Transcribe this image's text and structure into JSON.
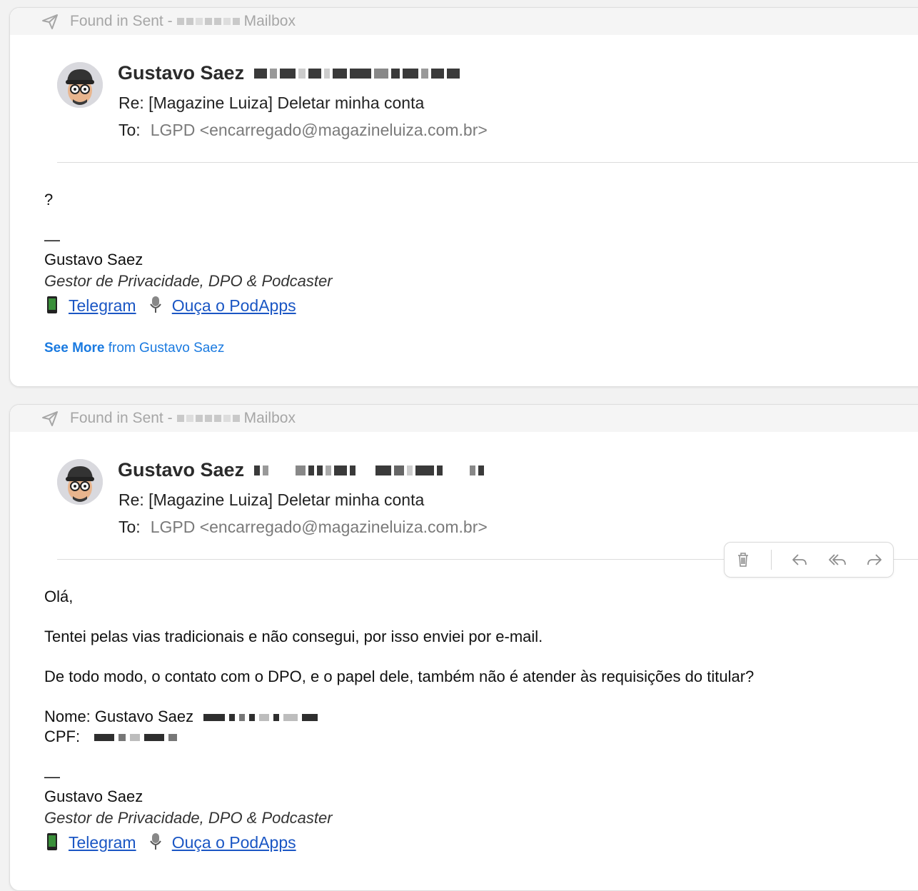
{
  "messages": [
    {
      "found_label": "Found in Sent -",
      "mailbox_label": "Mailbox",
      "sender": "Gustavo Saez",
      "subject": "Re: [Magazine Luiza] Deletar minha conta",
      "to_label": "To:",
      "to_value": "LGPD <encarregado@magazineluiza.com.br>",
      "body": [
        "?"
      ],
      "signature": {
        "dash": "—",
        "name": "Gustavo Saez",
        "title": "Gestor de Privacidade, DPO & Podcaster",
        "telegram": "Telegram",
        "podapps": "Ouça o PodApps"
      },
      "see_more": {
        "bold": "See More",
        "rest": "from Gustavo Saez"
      }
    },
    {
      "found_label": "Found in Sent -",
      "mailbox_label": "Mailbox",
      "sender": "Gustavo Saez",
      "subject": "Re: [Magazine Luiza] Deletar minha conta",
      "to_label": "To:",
      "to_value": "LGPD <encarregado@magazineluiza.com.br>",
      "body": [
        "Olá,",
        "Tentei pelas vias tradicionais e não consegui, por isso enviei por e-mail.",
        "De todo modo, o contato com o DPO, e o papel dele, também não é atender às requisições do titular?"
      ],
      "fields": {
        "nome_label": "Nome: Gustavo Saez",
        "cpf_label": "CPF:"
      },
      "signature": {
        "dash": "—",
        "name": "Gustavo Saez",
        "title": "Gestor de Privacidade, DPO & Podcaster",
        "telegram": "Telegram",
        "podapps": "Ouça o PodApps"
      }
    }
  ],
  "toolbar_icons": [
    "trash-icon",
    "reply-icon",
    "reply-all-icon",
    "forward-icon"
  ],
  "colors": {
    "link": "#1a56c4",
    "see_more": "#1a7ae0",
    "muted": "#a6a6a6"
  }
}
